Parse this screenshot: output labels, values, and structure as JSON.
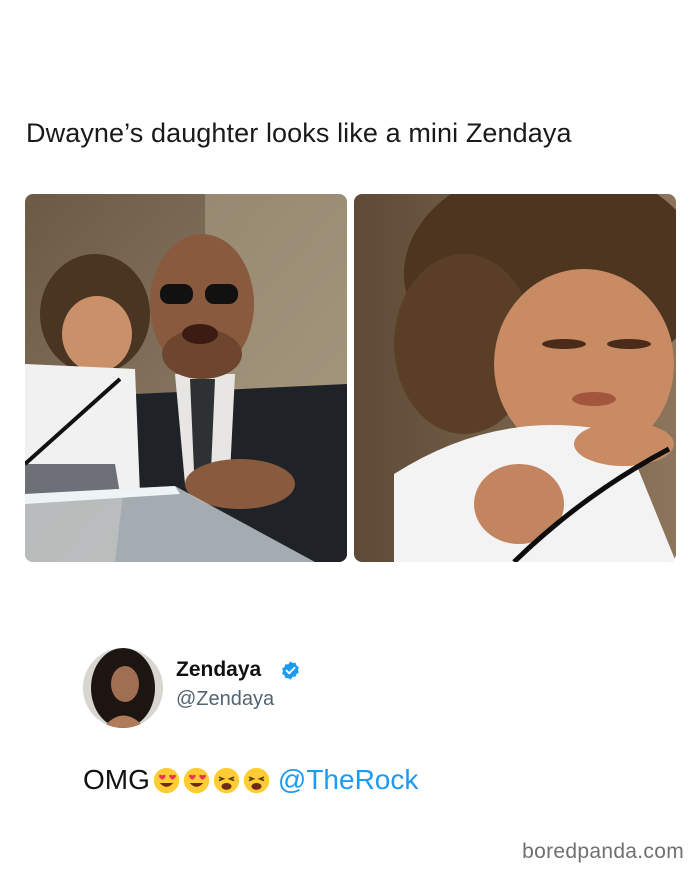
{
  "post": {
    "caption": "Dwayne’s daughter looks like a mini Zendaya"
  },
  "photos": [
    {
      "icon": "photo-man-holding-child"
    },
    {
      "icon": "photo-child-closeup"
    }
  ],
  "tweet": {
    "name": "Zendaya",
    "handle": "@Zendaya",
    "verified_color": "#1d9bf0",
    "text_prefix": "OMG",
    "emojis": [
      "heart-eyes-emoji",
      "heart-eyes-emoji",
      "weary-face-emoji",
      "weary-face-emoji"
    ],
    "mention": "@TheRock",
    "mention_color": "#1d9bf0"
  },
  "watermark": "boredpanda.com"
}
